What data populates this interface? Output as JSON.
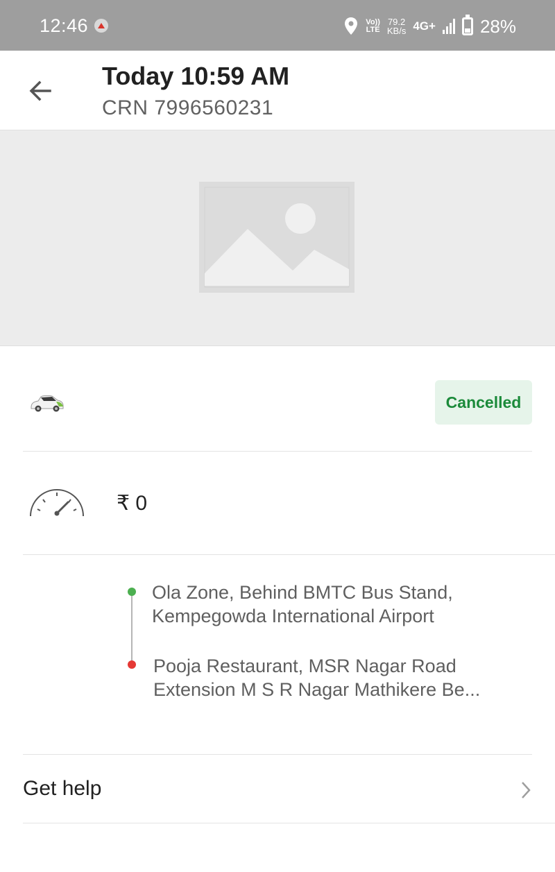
{
  "status_bar": {
    "time": "12:46",
    "volte": "Vo)) LTE",
    "volte_top": "Vo))",
    "volte_bottom": "LTE",
    "speed_value": "79.2",
    "speed_unit": "KB/s",
    "network": "4G+",
    "battery": "28%",
    "battery_level": 0.28
  },
  "header": {
    "title": "Today 10:59 AM",
    "crn": "CRN 7996560231"
  },
  "ride": {
    "status": "Cancelled",
    "fare": "₹ 0",
    "pickup": "Ola Zone, Behind BMTC Bus Stand, Kempegowda International Airport",
    "drop": "Pooja Restaurant, MSR Nagar Road Extension M S R Nagar Mathikere Be..."
  },
  "help": {
    "label": "Get help"
  },
  "colors": {
    "status_bar": "#9e9e9e",
    "cancelled_text": "#1b8a3a",
    "cancelled_bg": "#e6f4ea",
    "pickup_dot": "#4caf50",
    "drop_dot": "#e53935"
  }
}
